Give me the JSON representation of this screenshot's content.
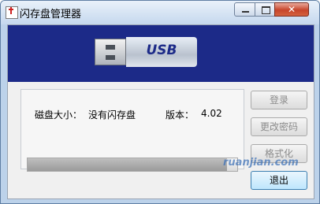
{
  "window": {
    "title": "闪存盘管理器"
  },
  "banner": {
    "usb_text": "USB"
  },
  "info": {
    "disk_size_label": "磁盘大小：",
    "disk_size_value": "没有闪存盘",
    "version_label": "版本：",
    "version_value": "4.02"
  },
  "buttons": {
    "login": "登录",
    "change_password": "更改密码",
    "format": "格式化",
    "exit": "退出"
  },
  "progress": {
    "fraction": 0.95
  },
  "watermark": {
    "text": "ruanjian.com"
  }
}
